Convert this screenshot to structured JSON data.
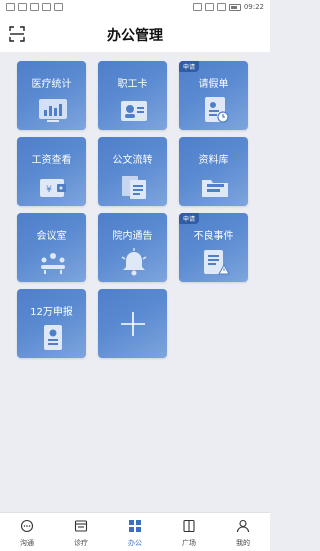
{
  "status_bar": {
    "icons_left": [
      "sim-icon",
      "wifi-icon",
      "app-icon",
      "app-icon",
      "app-icon"
    ],
    "icons_right": [
      "alarm-icon",
      "vibrate-icon",
      "wifi-icon",
      "battery-icon"
    ],
    "time": "09:22"
  },
  "header": {
    "title": "办公管理",
    "left_icon": "scan-icon"
  },
  "tiles": [
    {
      "label": "医疗统计",
      "badge": "",
      "icon": "chart-icon"
    },
    {
      "label": "职工卡",
      "badge": "",
      "icon": "id-card-icon"
    },
    {
      "label": "请假单",
      "badge": "申请",
      "icon": "leave-form-icon"
    },
    {
      "label": "工资查看",
      "badge": "",
      "icon": "wallet-icon"
    },
    {
      "label": "公文流转",
      "badge": "",
      "icon": "document-flow-icon"
    },
    {
      "label": "资料库",
      "badge": "",
      "icon": "folder-icon"
    },
    {
      "label": "会议室",
      "badge": "",
      "icon": "meeting-icon"
    },
    {
      "label": "院内通告",
      "badge": "",
      "icon": "bell-icon"
    },
    {
      "label": "不良事件",
      "badge": "申请",
      "icon": "warning-list-icon"
    },
    {
      "label": "12万申报",
      "badge": "",
      "icon": "report-icon"
    }
  ],
  "add_tile": {
    "icon": "plus-icon"
  },
  "tabbar": {
    "items": [
      {
        "label": "沟通",
        "icon": "chat-icon",
        "active": false
      },
      {
        "label": "诊疗",
        "icon": "clinic-icon",
        "active": false
      },
      {
        "label": "办公",
        "icon": "office-grid-icon",
        "active": true
      },
      {
        "label": "广场",
        "icon": "book-icon",
        "active": false
      },
      {
        "label": "我的",
        "icon": "person-icon",
        "active": false
      }
    ]
  }
}
